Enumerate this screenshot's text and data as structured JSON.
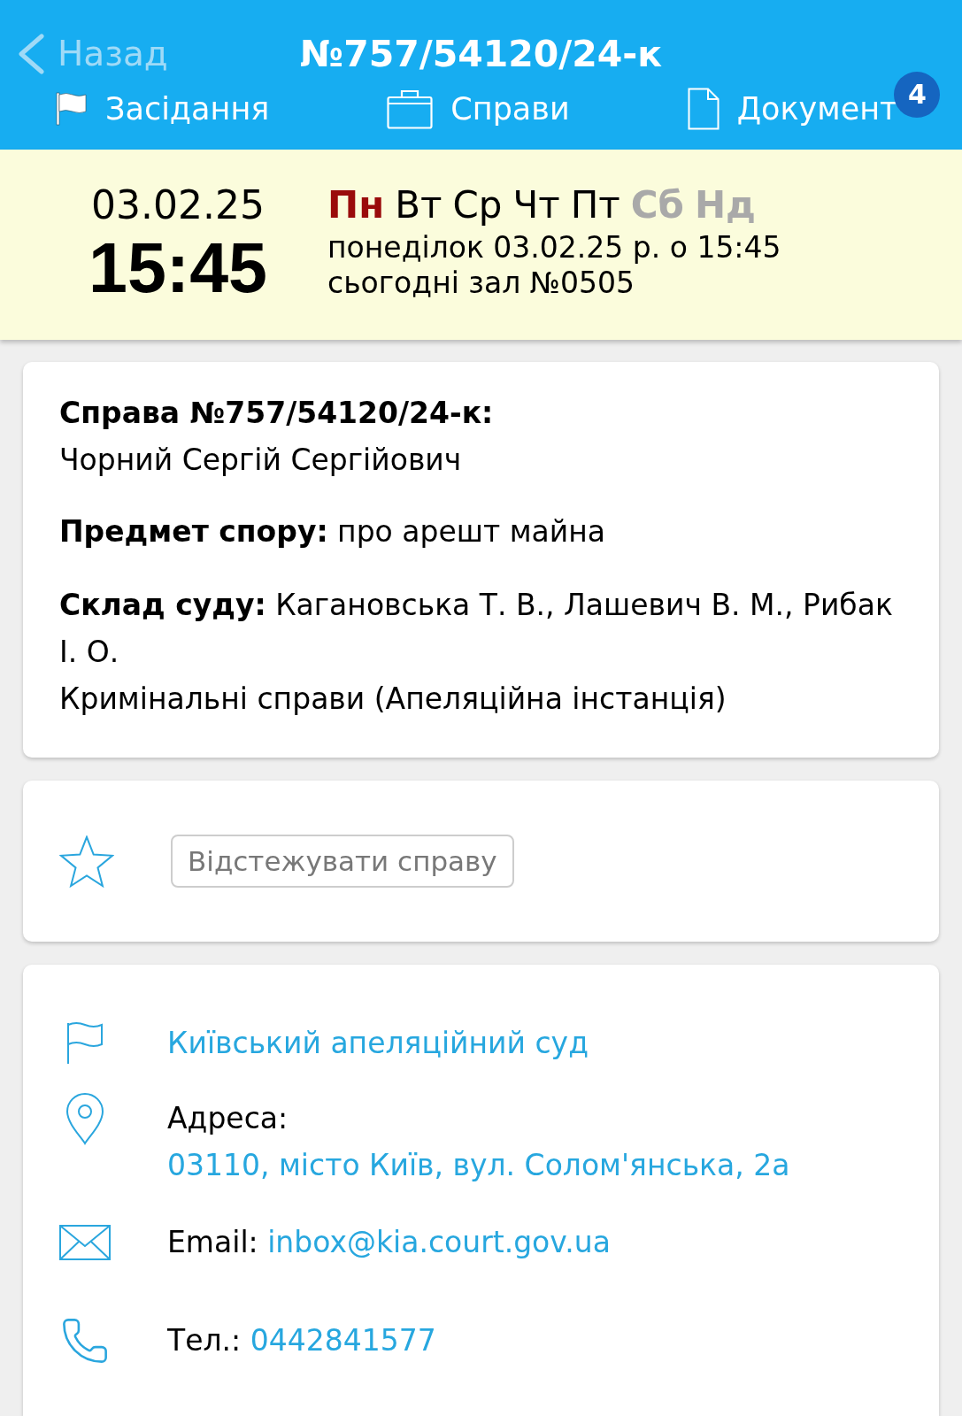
{
  "nav": {
    "back": "Назад",
    "title": "№757/54120/24-к"
  },
  "tabs": [
    {
      "label": "Засідання"
    },
    {
      "label": "Справи"
    },
    {
      "label": "Документ",
      "badge": "4"
    }
  ],
  "schedule": {
    "date": "03.02.25",
    "time": "15:45",
    "days": [
      {
        "label": "Пн",
        "selected": true,
        "weekend": false
      },
      {
        "label": "Вт",
        "selected": false,
        "weekend": false
      },
      {
        "label": "Ср",
        "selected": false,
        "weekend": false
      },
      {
        "label": "Чт",
        "selected": false,
        "weekend": false
      },
      {
        "label": "Пт",
        "selected": false,
        "weekend": false
      },
      {
        "label": "Сб",
        "selected": false,
        "weekend": true
      },
      {
        "label": "Нд",
        "selected": false,
        "weekend": true
      }
    ],
    "details": [
      "понеділок 03.02.25 р. о 15:45",
      "сьогодні зал №0505"
    ]
  },
  "case": {
    "number": "Справа №757/54120/24-к:",
    "party": "Чорний Сергій Сергійович",
    "subject": "**Предмет спору:** про арешт майна",
    "judges": "**Склад суду:** Кагановська Т. В., Лашевич В. М., Рибак І. О.",
    "category": "Кримінальні справи (Апеляційна інстанція)"
  },
  "tracking": {
    "tracked": false,
    "button": "Відстежувати справу"
  },
  "court": {
    "name": "Київський апеляційний суд",
    "contacts": [
      {
        "label": "Адреса:",
        "value": "03110, місто Київ, вул. Солом'янська, 2а"
      },
      {
        "label": "Email:",
        "value": "inbox@kia.court.gov.ua"
      },
      {
        "label": "Тел.:",
        "value": "0442841577"
      }
    ]
  }
}
